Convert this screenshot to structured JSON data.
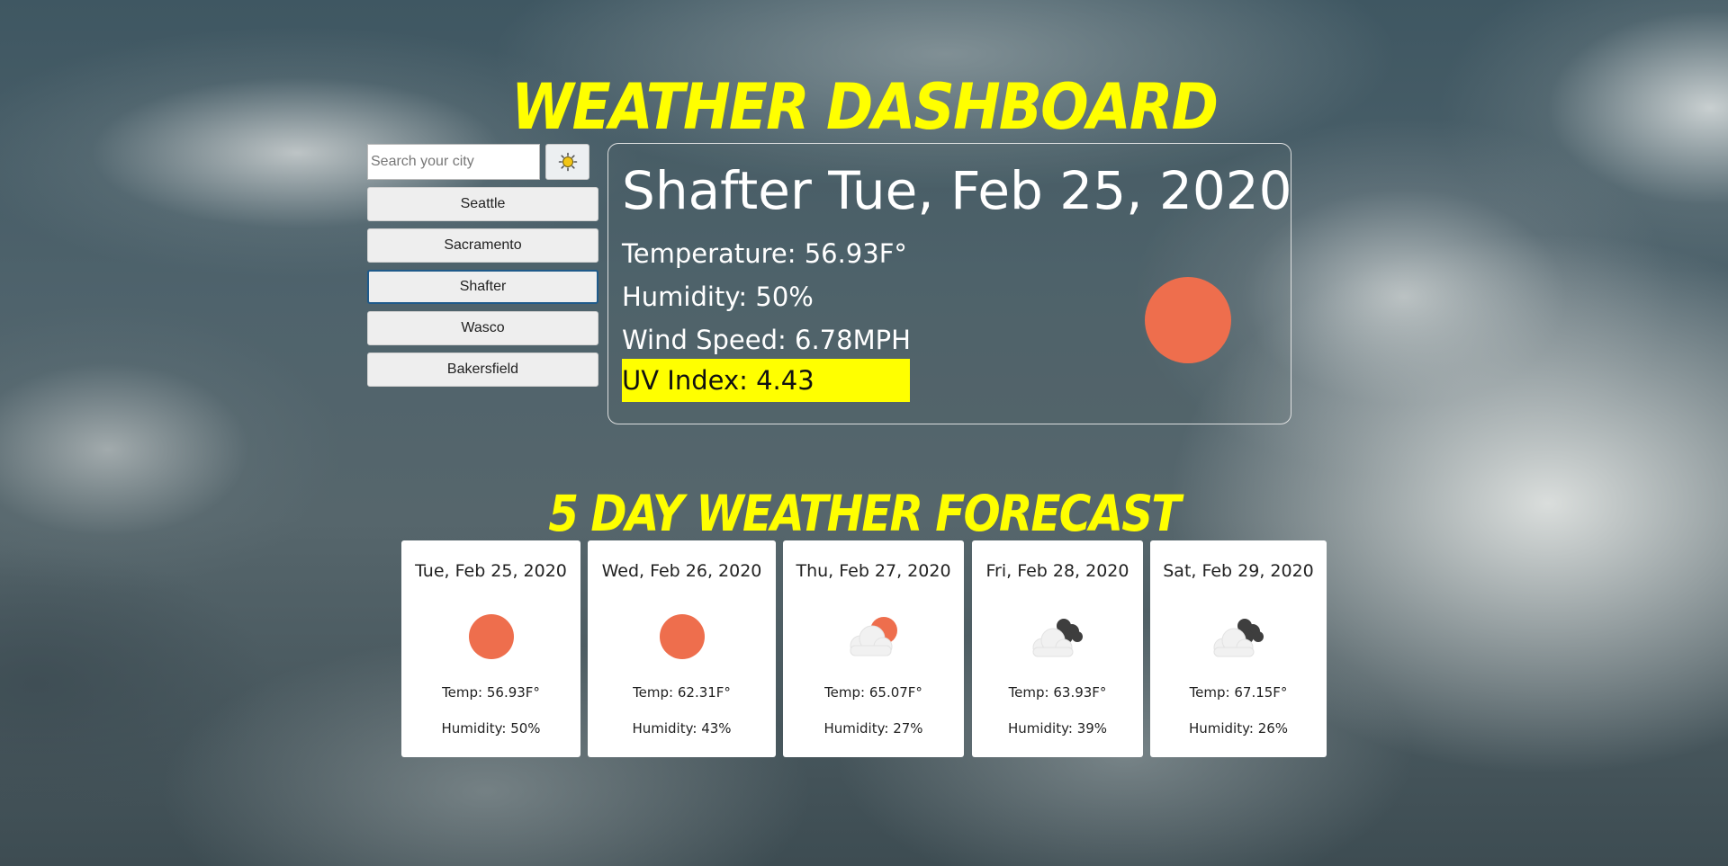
{
  "header": {
    "title": "WEATHER DASHBOARD"
  },
  "search": {
    "placeholder": "Search your city",
    "value": "",
    "button_icon": "sun-icon"
  },
  "cities": [
    "Seattle",
    "Sacramento",
    "Shafter",
    "Wasco",
    "Bakersfield"
  ],
  "active_city": "Shafter",
  "current": {
    "title": "Shafter Tue, Feb 25, 2020",
    "temperature": "Temperature: 56.93F°",
    "humidity": "Humidity: 50%",
    "wind": "Wind Speed: 6.78MPH",
    "uv": "UV Index: 4.43",
    "icon": "sun-icon"
  },
  "forecast_title": "5 DAY WEATHER FORECAST",
  "forecast": [
    {
      "date": "Tue, Feb 25, 2020",
      "icon": "sun-icon",
      "temp": "Temp: 56.93F°",
      "humidity": "Humidity: 50%"
    },
    {
      "date": "Wed, Feb 26, 2020",
      "icon": "sun-icon",
      "temp": "Temp: 62.31F°",
      "humidity": "Humidity: 43%"
    },
    {
      "date": "Thu, Feb 27, 2020",
      "icon": "partly-cloudy-icon",
      "temp": "Temp: 65.07F°",
      "humidity": "Humidity: 27%"
    },
    {
      "date": "Fri, Feb 28, 2020",
      "icon": "broken-clouds-icon",
      "temp": "Temp: 63.93F°",
      "humidity": "Humidity: 39%"
    },
    {
      "date": "Sat, Feb 29, 2020",
      "icon": "broken-clouds-icon",
      "temp": "Temp: 67.15F°",
      "humidity": "Humidity: 26%"
    }
  ],
  "colors": {
    "accent_yellow": "#ffff00",
    "sun": "#ee6e4d",
    "active_border": "#1f5a8a"
  }
}
